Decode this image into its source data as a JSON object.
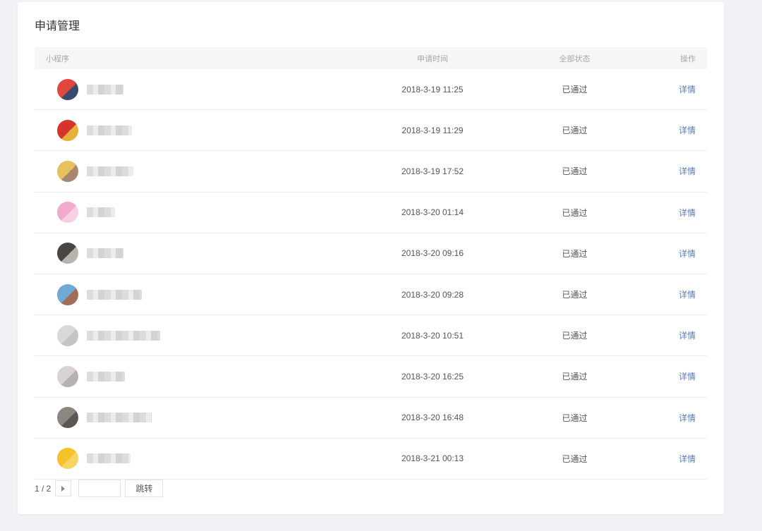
{
  "page": {
    "title": "申请管理"
  },
  "table": {
    "headers": {
      "app": "小程序",
      "time": "申请时间",
      "status": "全部状态",
      "op": "操作"
    },
    "rows": [
      {
        "time": "2018-3-19 11:25",
        "status": "已通过",
        "op": "详情",
        "avatar_color": "#e2463c",
        "avatar_color2": "#3b4a6b"
      },
      {
        "time": "2018-3-19 11:29",
        "status": "已通过",
        "op": "详情",
        "avatar_color": "#d6342a",
        "avatar_color2": "#e8b03a"
      },
      {
        "time": "2018-3-19 17:52",
        "status": "已通过",
        "op": "详情",
        "avatar_color": "#e7c15d",
        "avatar_color2": "#a9876f"
      },
      {
        "time": "2018-3-20 01:14",
        "status": "已通过",
        "op": "详情",
        "avatar_color": "#f0aacb",
        "avatar_color2": "#f7d1e2"
      },
      {
        "time": "2018-3-20 09:16",
        "status": "已通过",
        "op": "详情",
        "avatar_color": "#4a4443",
        "avatar_color2": "#b9b3ad"
      },
      {
        "time": "2018-3-20 09:28",
        "status": "已通过",
        "op": "详情",
        "avatar_color": "#6fa9d6",
        "avatar_color2": "#a26e5b"
      },
      {
        "time": "2018-3-20 10:51",
        "status": "已通过",
        "op": "详情",
        "avatar_color": "#d9d9d9",
        "avatar_color2": "#c4c4c4"
      },
      {
        "time": "2018-3-20 16:25",
        "status": "已通过",
        "op": "详情",
        "avatar_color": "#d8d2d2",
        "avatar_color2": "#b7b0b0"
      },
      {
        "time": "2018-3-20 16:48",
        "status": "已通过",
        "op": "详情",
        "avatar_color": "#8b8680",
        "avatar_color2": "#5c5753"
      },
      {
        "time": "2018-3-21 00:13",
        "status": "已通过",
        "op": "详情",
        "avatar_color": "#f5c22a",
        "avatar_color2": "#f7d560"
      }
    ]
  },
  "pagination": {
    "info": "1 / 2",
    "jump_input_value": "",
    "jump_label": "跳转",
    "next_icon": "caret-right-icon"
  }
}
